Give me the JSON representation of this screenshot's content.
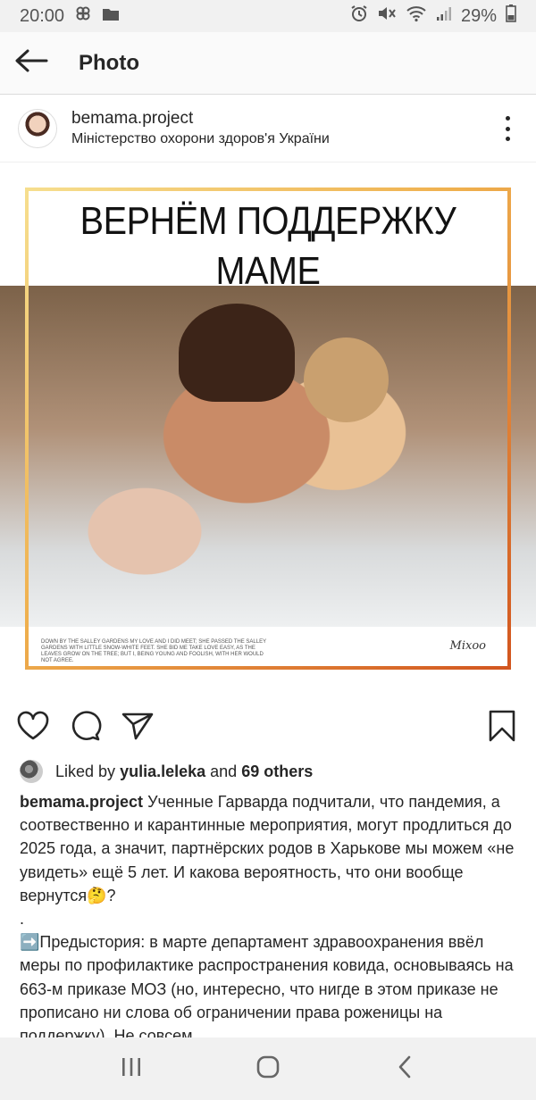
{
  "status_bar": {
    "time": "20:00",
    "battery": "29%"
  },
  "header": {
    "title": "Photo",
    "back_icon": "back-arrow-icon"
  },
  "post": {
    "username": "bemama.project",
    "location": "Міністерство охорони здоров'я України",
    "image": {
      "title": "ВЕРНЁМ ПОДДЕРЖКУ МАМЕ",
      "small_print": "DOWN BY THE SALLEY GARDENS MY LOVE AND I DID MEET; SHE PASSED THE SALLEY GARDENS WITH LITTLE SNOW-WHITE FEET. SHE BID ME TAKE LOVE EASY, AS THE LEAVES GROW ON THE TREE; BUT I, BEING YOUNG AND FOOLISH, WITH HER WOULD NOT AGREE.",
      "signature": "Mixoo"
    },
    "likes": {
      "prefix": "Liked by",
      "user": "yulia.leleka",
      "conjunction": "and",
      "others": "69 others"
    },
    "caption": {
      "username": "bemama.project",
      "paragraph_1": "Ученные Гарварда подчитали, что пандемия, а соотвественно и карантинные мероприятия, могут продлиться до 2025 года, а значит, партнёрских родов в Харькове мы можем «не увидеть» ещё 5 лет. И какова вероятность, что они вообще вернутся🤔?",
      "dot": ".",
      "paragraph_2": "➡️Предыстория: в марте департамент здравоохранения ввёл меры по профилактике распространения ковида, основываясь на 663-м приказе МОЗ (но, интересно, что нигде в этом приказе не прописано ни слова об ограничении права роженицы на поддержку). Не совсем"
    }
  }
}
